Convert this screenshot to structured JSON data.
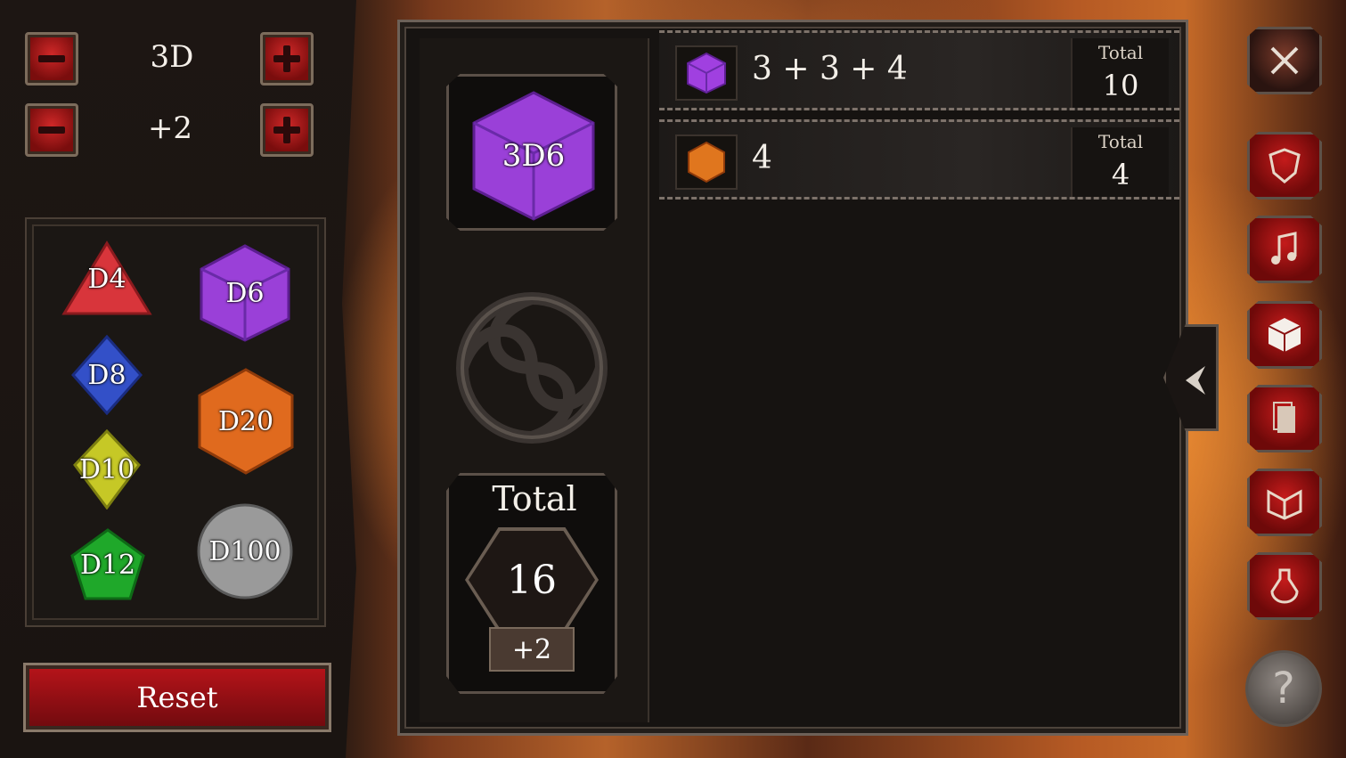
{
  "dice_controls": {
    "count_value": "3D",
    "modifier_value": "+2"
  },
  "dice_palette": [
    {
      "label": "D4",
      "color": "#d8353b"
    },
    {
      "label": "D6",
      "color": "#9a40d8"
    },
    {
      "label": "D8",
      "color": "#3350c8"
    },
    {
      "label": "D20",
      "color": "#e06a1e"
    },
    {
      "label": "D10",
      "color": "#c6c826"
    },
    {
      "label": "D12",
      "color": "#1fa82a"
    },
    {
      "label": "D100",
      "color": "#9a9a9a"
    }
  ],
  "reset_label": "Reset",
  "roller": {
    "selected_die": "3D6",
    "total_label": "Total",
    "total_value": "16",
    "modifier": "+2"
  },
  "results": [
    {
      "expr": "3 + 3 + 4",
      "total_label": "Total",
      "total_value": "10",
      "icon": "d6-cube-icon",
      "color": "#a040e0"
    },
    {
      "expr": "4",
      "total_label": "Total",
      "total_value": "4",
      "icon": "d20-hex-icon",
      "color": "#e0761e"
    }
  ],
  "sidebar": {
    "items": [
      "crossed-swords-icon",
      "shield-icon",
      "music-note-icon",
      "dice-cube-icon",
      "cards-icon",
      "open-book-icon",
      "potion-icon"
    ],
    "help": "?"
  }
}
